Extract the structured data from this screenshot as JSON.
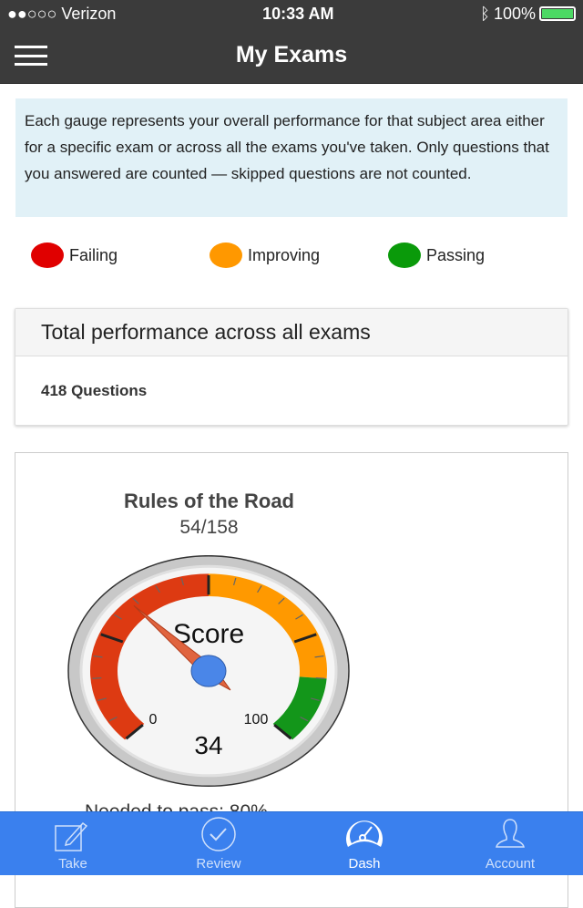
{
  "status_bar": {
    "carrier": "●●○○○ Verizon",
    "time": "10:33 AM",
    "battery": "100%"
  },
  "header": {
    "title": "My Exams"
  },
  "info": {
    "text": "Each gauge represents your overall performance for that subject area either for a specific exam or across all the exams you've taken. Only questions that you answered are counted — skipped questions are not counted."
  },
  "legend": [
    {
      "label": "Failing",
      "color": "#e00000"
    },
    {
      "label": "Improving",
      "color": "#ff9800"
    },
    {
      "label": "Passing",
      "color": "#0a9a0a"
    }
  ],
  "total_card": {
    "title": "Total performance across all exams",
    "questions": "418 Questions"
  },
  "gauge": {
    "title": "Rules of the Road",
    "fraction": "54/158",
    "label": "Score",
    "min": "0",
    "max": "100",
    "value": 34,
    "value_text": "34",
    "bands": [
      {
        "from": 0,
        "to": 50,
        "color": "#dd3a12"
      },
      {
        "from": 50,
        "to": 85,
        "color": "#ff9900"
      },
      {
        "from": 85,
        "to": 100,
        "color": "#13961a"
      }
    ],
    "needed_label": "Needed to pass:",
    "needed_value": "80%"
  },
  "tabs": [
    {
      "label": "Take",
      "icon": "pencil-square-icon"
    },
    {
      "label": "Review",
      "icon": "check-circle-icon"
    },
    {
      "label": "Dash",
      "icon": "dashboard-icon",
      "active": true
    },
    {
      "label": "Account",
      "icon": "user-icon"
    }
  ]
}
